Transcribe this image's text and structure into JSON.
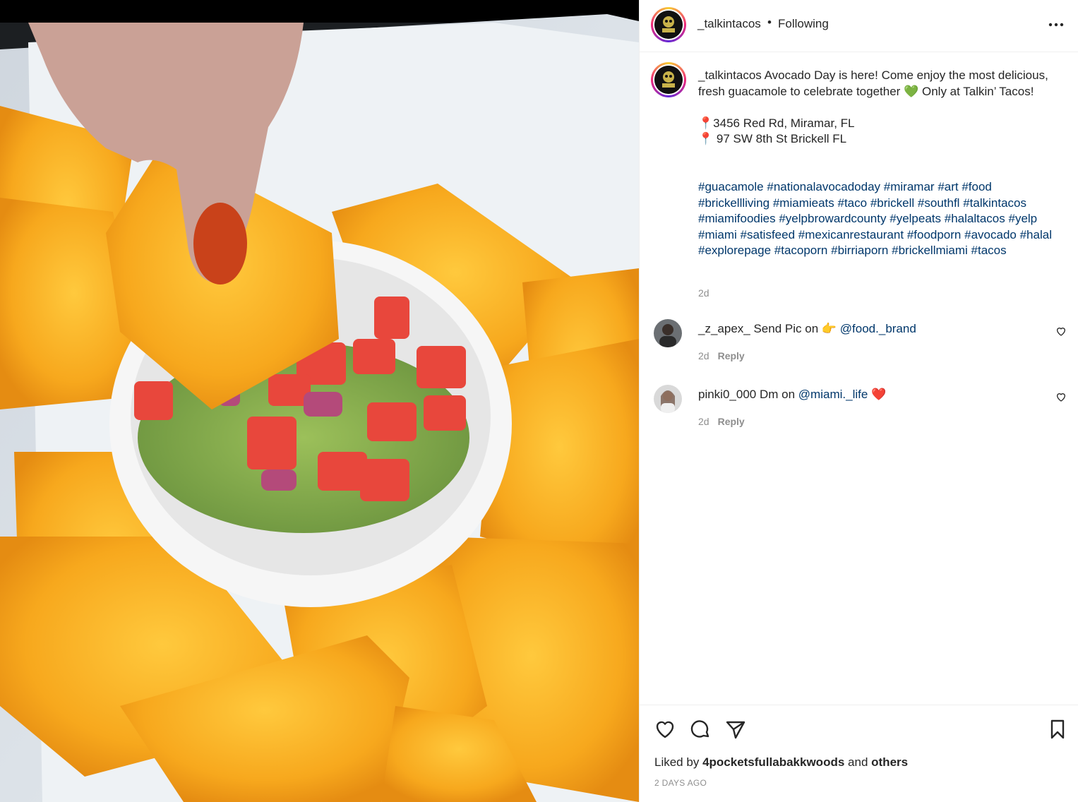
{
  "post": {
    "username": "_talkintacos",
    "separator": "•",
    "follow_status": "Following",
    "avatar_label": "TALKIN TACOS"
  },
  "caption": {
    "username": "_talkintacos",
    "text_line1": "Avocado Day is here! Come enjoy the most delicious, fresh guacamole to celebrate together",
    "heart_emoji": "💚",
    "text_line2": "Only at Talkin’ Tacos!",
    "pin": "📍",
    "address1": "3456 Red Rd, Miramar, FL",
    "address2": " 97 SW 8th St Brickell FL",
    "hashtags": [
      "#guacamole",
      "#nationalavocadoday",
      "#miramar",
      "#art",
      "#food",
      "#brickellliving",
      "#miamieats",
      "#taco",
      "#brickell",
      "#southfl",
      "#talkintacos",
      "#miamifoodies",
      "#yelpbrowardcounty",
      "#yelpeats",
      "#halaltacos",
      "#yelp",
      "#miami",
      "#satisfeed",
      "#mexicanrestaurant",
      "#foodporn",
      "#avocado",
      "#halal",
      "#explorepage",
      "#tacoporn",
      "#birriaporn",
      "#brickellmiami",
      "#tacos"
    ],
    "time": "2d"
  },
  "comments": [
    {
      "username": "_z_apex_",
      "text": "Send Pic on",
      "emoji": "👉",
      "mention": "@food._brand",
      "time": "2d",
      "reply": "Reply"
    },
    {
      "username": "pinki0_000",
      "text": "Dm on",
      "emoji": "❤️",
      "mention": "@miami._life",
      "time": "2d",
      "reply": "Reply"
    }
  ],
  "footer": {
    "liked_by_prefix": "Liked by",
    "liked_by_user": "4pocketsfullabakkwoods",
    "and": "and",
    "others": "others",
    "date": "2 DAYS AGO"
  },
  "icons": {
    "like": "heart-icon",
    "comment": "comment-icon",
    "share": "paper-plane-icon",
    "save": "bookmark-icon",
    "more": "more-icon"
  }
}
